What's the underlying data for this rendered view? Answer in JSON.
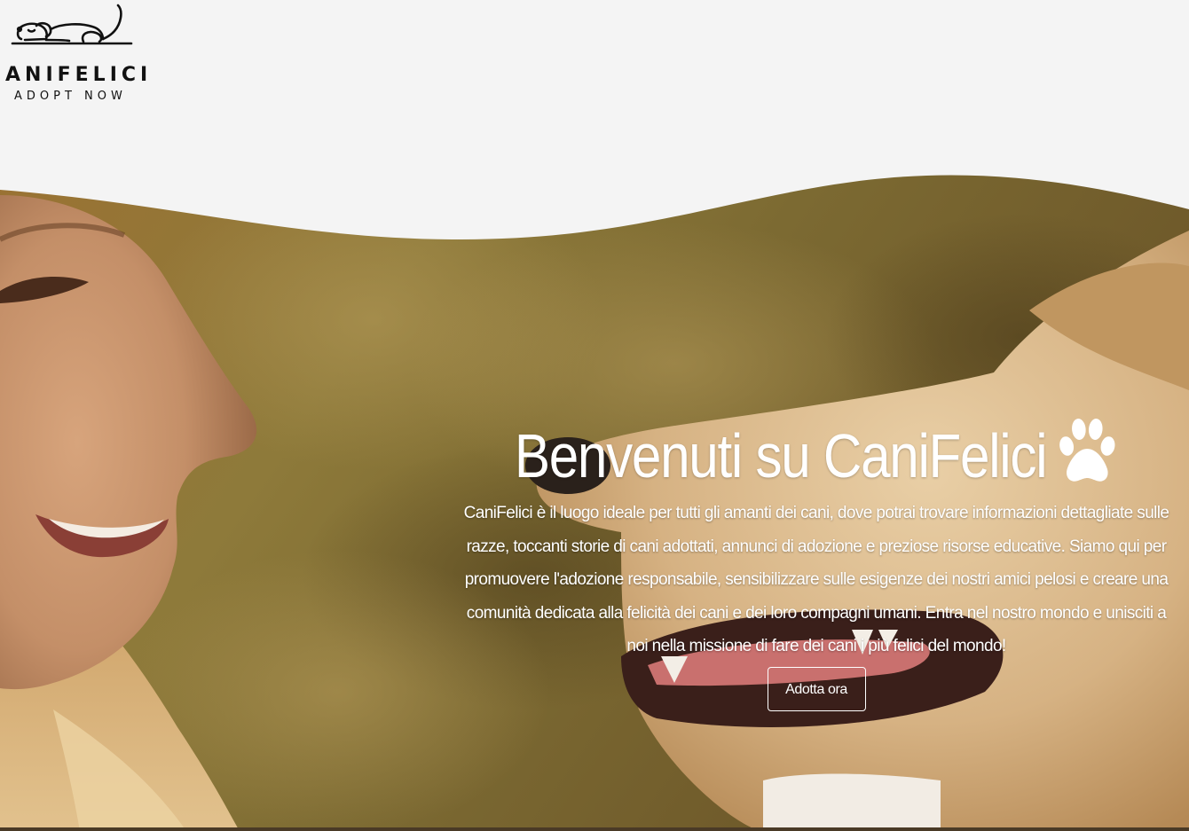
{
  "brand": {
    "name": "ANIFELICI",
    "tagline": "ADOPT NOW",
    "logo_icon": "sleeping-dog-icon"
  },
  "hero": {
    "title": "Benvenuti su CaniFelici",
    "title_icon": "paw-icon",
    "description": "CaniFelici è il luogo ideale per tutti gli amanti dei cani, dove potrai trovare informazioni dettagliate sulle razze, toccanti storie di cani adottati, annunci di adozione e preziose risorse educative. Siamo qui per promuovere l'adozione responsabile, sensibilizzare sulle esigenze dei nostri amici pelosi e creare una comunità dedicata alla felicità dei cani e dei loro compagni umani. Entra nel nostro mondo e unisciti a noi nella missione di fare dei cani i più felici del mondo!",
    "button_label": "Adotta ora",
    "background_image": "woman-and-dog-photo"
  },
  "colors": {
    "page_background": "#f4f4f4",
    "hero_text": "#ffffff",
    "logo_text": "#111111"
  }
}
